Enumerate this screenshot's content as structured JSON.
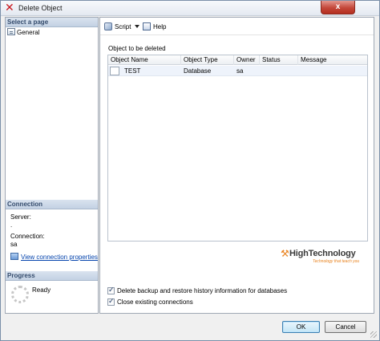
{
  "window": {
    "title": "Delete Object",
    "close_glyph": "x"
  },
  "left": {
    "select_page_header": "Select a page",
    "pages": [
      {
        "label": "General"
      }
    ],
    "connection_header": "Connection",
    "server_label": "Server:",
    "server_value": ".",
    "connection_label": "Connection:",
    "connection_value": "sa",
    "view_link": "View connection properties",
    "progress_header": "Progress",
    "status": "Ready"
  },
  "toolbar": {
    "script_label": "Script",
    "help_label": "Help"
  },
  "main": {
    "caption": "Object to be deleted",
    "columns": [
      "Object Name",
      "Object Type",
      "Owner",
      "Status",
      "Message"
    ],
    "rows": [
      {
        "name": "TEST",
        "type": "Database",
        "owner": "sa",
        "status": "",
        "message": ""
      }
    ],
    "brand_name": "HighTechnology",
    "brand_tag": "Technology that teach you",
    "option_backup": "Delete backup and restore history information for databases",
    "option_close": "Close existing connections"
  },
  "footer": {
    "ok_label": "OK",
    "cancel_label": "Cancel"
  },
  "colors": {
    "accent": "#3c7fb1",
    "link": "#0645ad",
    "brand": "#e8821e"
  }
}
